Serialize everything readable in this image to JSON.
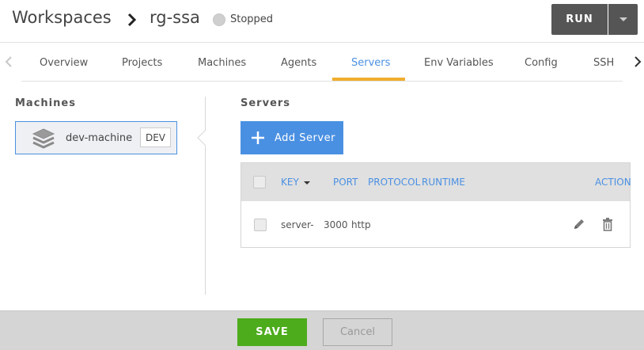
{
  "header": {
    "breadcrumb_root": "Workspaces",
    "workspace_name": "rg-ssa",
    "status": "Stopped",
    "run_label": "RUN"
  },
  "tabs": [
    {
      "label": "Overview"
    },
    {
      "label": "Projects"
    },
    {
      "label": "Machines"
    },
    {
      "label": "Agents"
    },
    {
      "label": "Servers",
      "active": true
    },
    {
      "label": "Env Variables"
    },
    {
      "label": "Config"
    },
    {
      "label": "SSH"
    }
  ],
  "machines": {
    "title": "Machines",
    "items": [
      {
        "name": "dev-machine",
        "badge": "DEV"
      }
    ]
  },
  "servers": {
    "title": "Servers",
    "add_label": "Add Server",
    "columns": {
      "key": "KEY",
      "port": "PORT",
      "protocol": "PROTOCOL",
      "runtime": "RUNTIME",
      "actions": "ACTION"
    },
    "rows": [
      {
        "key": "server-",
        "port": "3000",
        "protocol": "http"
      }
    ]
  },
  "footer": {
    "save_label": "SAVE",
    "cancel_label": "Cancel"
  },
  "colors": {
    "accent": "#4a90e2",
    "active_tab_underline": "#f0ad2e",
    "save_green": "#4dac1c",
    "run_button": "#555555"
  }
}
